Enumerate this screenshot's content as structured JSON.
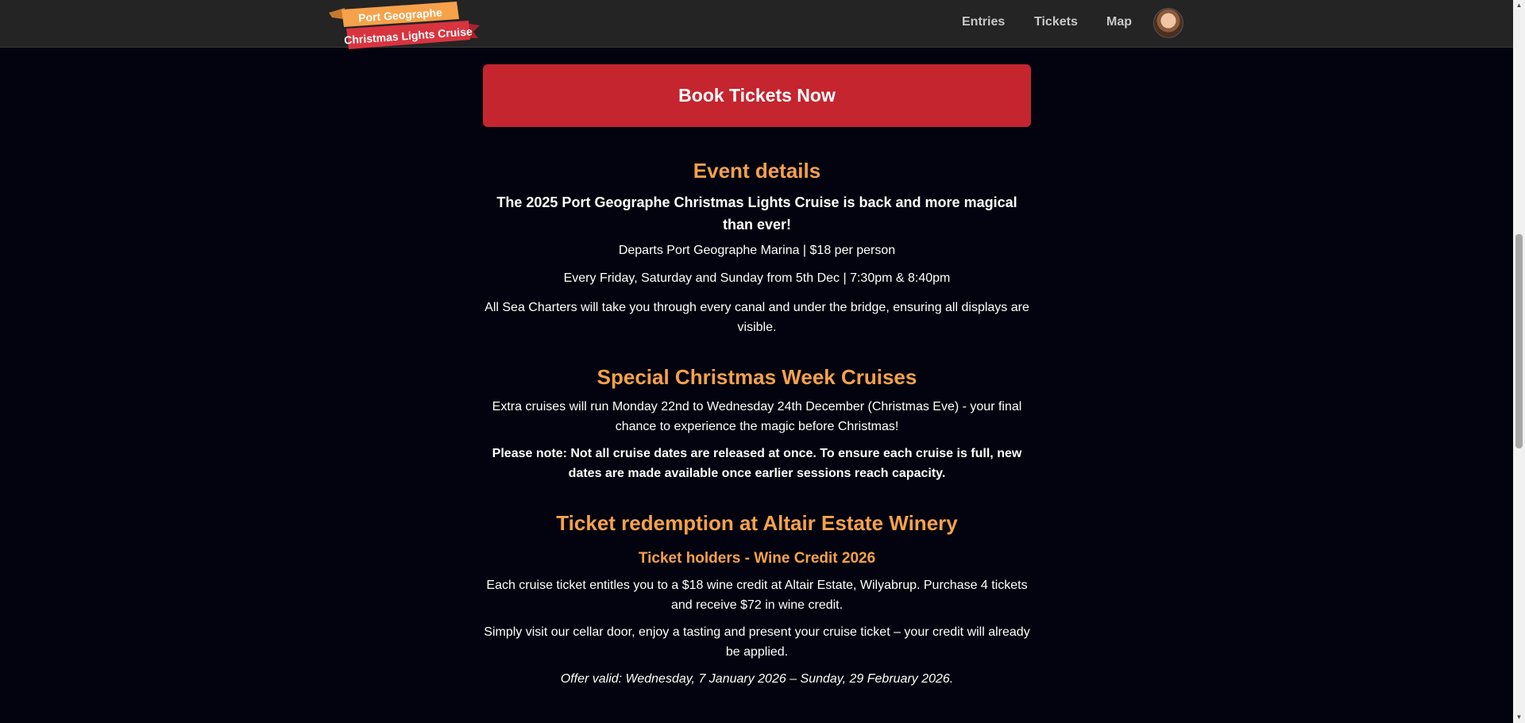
{
  "logo": {
    "line1": "Port Geographe",
    "line2": "Christmas Lights Cruise",
    "banner_top_color": "#f5a24a",
    "banner_bottom_color": "#d8343f"
  },
  "nav": {
    "entries": "Entries",
    "tickets": "Tickets",
    "map": "Map"
  },
  "book_button": "Book Tickets Now",
  "event_details": {
    "heading": "Event details",
    "lead": "The 2025 Port Geographe Christmas Lights Cruise is back and more magical than ever!",
    "line1": "Departs Port Geographe Marina | $18 per person",
    "line2": "Every Friday, Saturday and Sunday from 5th Dec | 7:30pm & 8:40pm",
    "line3": "All Sea Charters will take you through every canal and under the bridge, ensuring all displays are visible."
  },
  "christmas_week": {
    "heading": "Special Christmas Week Cruises",
    "line1": "Extra cruises will run Monday 22nd to Wednesday 24th December (Christmas Eve) - your final chance to experience the magic before Christmas!",
    "note": "Please note: Not all cruise dates are released at once. To ensure each cruise is full, new dates are made available once earlier sessions reach capacity."
  },
  "redemption": {
    "heading": "Ticket redemption at Altair Estate Winery",
    "subheading": "Ticket holders - Wine Credit 2026",
    "line1": "Each cruise ticket entitles you to a $18 wine credit at Altair Estate, Wilyabrup. Purchase 4 tickets and receive $72 in wine credit.",
    "line2": "Simply visit our cellar door, enjoy a tasting and present your cruise ticket – your credit will already be applied.",
    "offer": "Offer valid: Wednesday, 7 January 2026 – Sunday, 29 February 2026."
  },
  "colors": {
    "background": "#03030f",
    "topbar": "#242424",
    "accent_heading": "#f5a24a",
    "button": "#c4252f"
  }
}
